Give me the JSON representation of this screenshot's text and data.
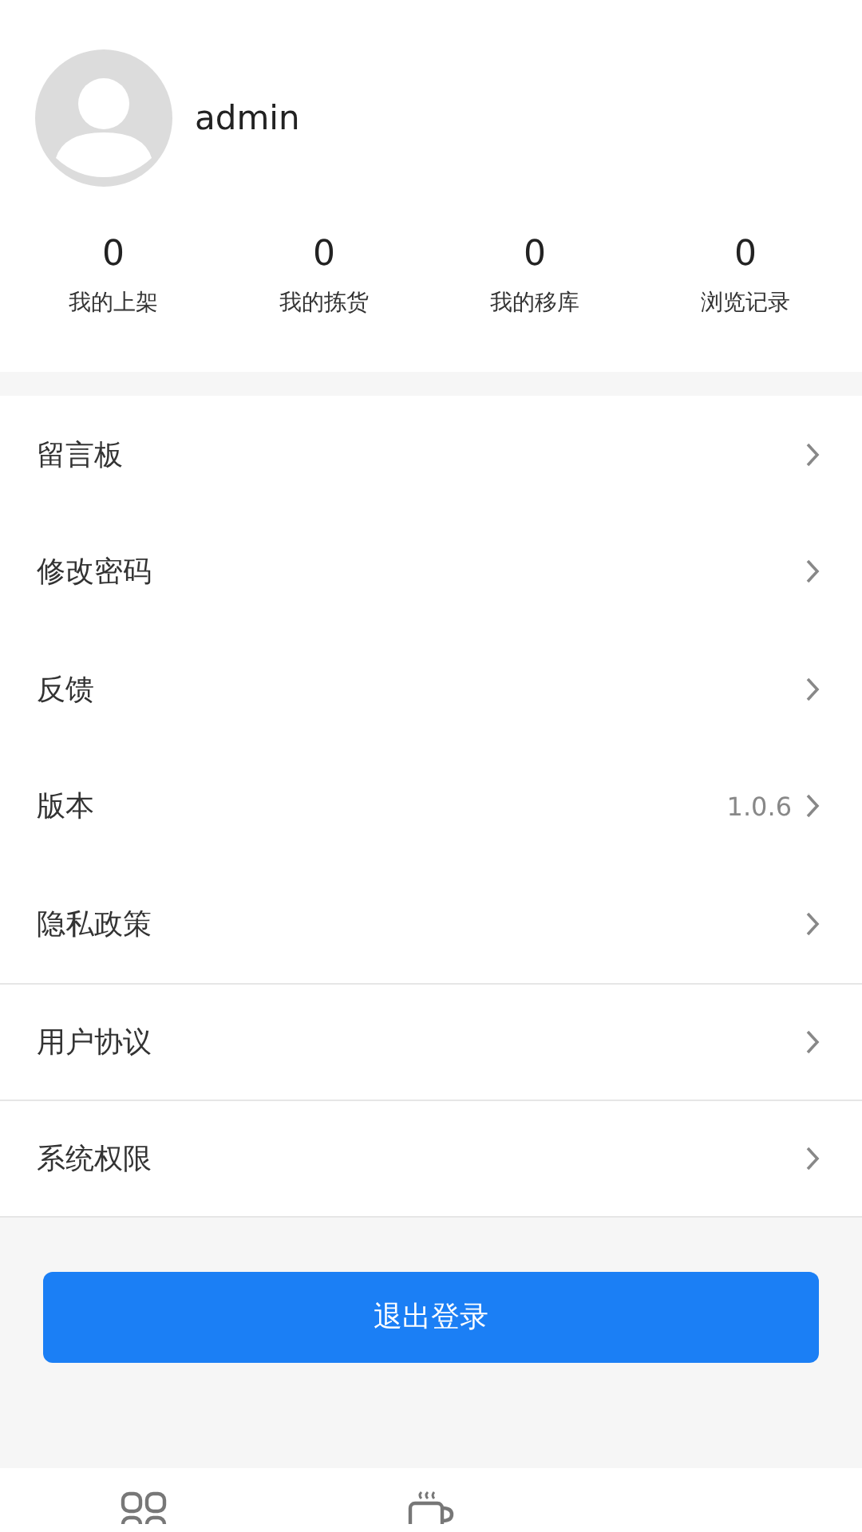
{
  "profile": {
    "username": "admin"
  },
  "stats": [
    {
      "value": "0",
      "label": "我的上架"
    },
    {
      "value": "0",
      "label": "我的拣货"
    },
    {
      "value": "0",
      "label": "我的移库"
    },
    {
      "value": "0",
      "label": "浏览记录"
    }
  ],
  "menu": [
    {
      "label": "留言板",
      "divider": false
    },
    {
      "label": "修改密码",
      "divider": false
    },
    {
      "label": "反馈",
      "divider": false
    },
    {
      "label": "版本",
      "value": "1.0.6",
      "divider": false
    },
    {
      "label": "隐私政策",
      "divider": false
    },
    {
      "label": "用户协议",
      "divider": true
    },
    {
      "label": "系统权限",
      "divider": true
    }
  ],
  "logout_button": "退出登录"
}
